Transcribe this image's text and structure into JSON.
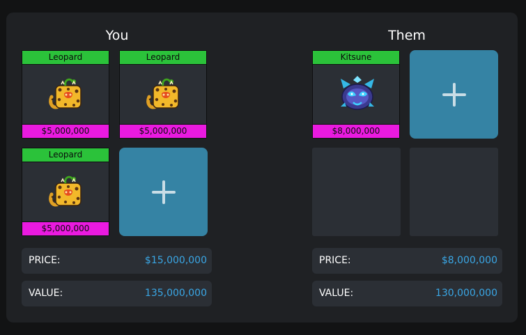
{
  "you": {
    "title": "You",
    "items": [
      {
        "name": "Leopard",
        "price": "$5,000,000",
        "icon": "leopard-fruit-icon"
      },
      {
        "name": "Leopard",
        "price": "$5,000,000",
        "icon": "leopard-fruit-icon"
      },
      {
        "name": "Leopard",
        "price": "$5,000,000",
        "icon": "leopard-fruit-icon"
      }
    ],
    "price_label": "PRICE:",
    "price_value": "$15,000,000",
    "value_label": "VALUE:",
    "value_value": "135,000,000"
  },
  "them": {
    "title": "Them",
    "items": [
      {
        "name": "Kitsune",
        "price": "$8,000,000",
        "icon": "kitsune-fruit-icon"
      }
    ],
    "price_label": "PRICE:",
    "price_value": "$8,000,000",
    "value_label": "VALUE:",
    "value_value": "130,000,000"
  },
  "colors": {
    "name_bar": "#2bc23a",
    "price_bar": "#ea1ae0",
    "add_slot": "#3583a4",
    "value_text": "#3aa7e6"
  }
}
